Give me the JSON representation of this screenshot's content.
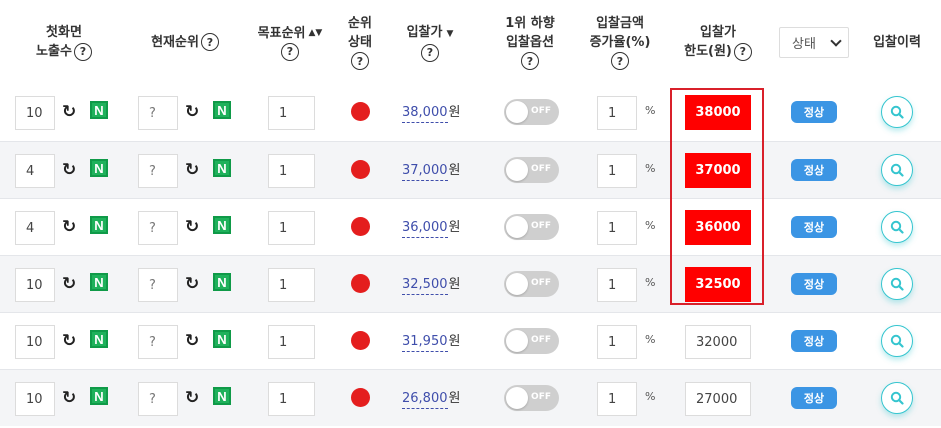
{
  "header": {
    "col_exposure_line1": "첫화면",
    "col_exposure_line2": "노출수",
    "col_current_rank": "현재순위",
    "col_target_rank": "목표순위",
    "col_rank_status_line1": "순위",
    "col_rank_status_line2": "상태",
    "col_bid": "입찰가",
    "col_option_line1": "1위 하향",
    "col_option_line2": "입찰옵션",
    "col_increase_line1": "입찰금액",
    "col_increase_line2": "증가율(%)",
    "col_limit_line1": "입찰가",
    "col_limit_line2": "한도(원)",
    "status_select": "상태",
    "col_history": "입찰이력",
    "help": "?",
    "sort_both": "▲▼",
    "sort_down": "▼"
  },
  "labels": {
    "naver": "N",
    "toggle": "OFF",
    "percent": "%",
    "won": "원"
  },
  "rows": [
    {
      "exposure": "10",
      "current_rank": "?",
      "target_rank": "1",
      "bid": "38,000",
      "increase": "1",
      "limit": "38000",
      "limit_highlight": true,
      "status": "정상"
    },
    {
      "exposure": "4",
      "current_rank": "?",
      "target_rank": "1",
      "bid": "37,000",
      "increase": "1",
      "limit": "37000",
      "limit_highlight": true,
      "status": "정상"
    },
    {
      "exposure": "4",
      "current_rank": "?",
      "target_rank": "1",
      "bid": "36,000",
      "increase": "1",
      "limit": "36000",
      "limit_highlight": true,
      "status": "정상"
    },
    {
      "exposure": "10",
      "current_rank": "?",
      "target_rank": "1",
      "bid": "32,500",
      "increase": "1",
      "limit": "32500",
      "limit_highlight": true,
      "status": "정상"
    },
    {
      "exposure": "10",
      "current_rank": "?",
      "target_rank": "1",
      "bid": "31,950",
      "increase": "1",
      "limit": "32000",
      "limit_highlight": false,
      "status": "정상"
    },
    {
      "exposure": "10",
      "current_rank": "?",
      "target_rank": "1",
      "bid": "26,800",
      "increase": "1",
      "limit": "27000",
      "limit_highlight": false,
      "status": "정상"
    }
  ],
  "colors": {
    "naver_green": "#1fb15b",
    "rank_dot_red": "#e41e1e",
    "limit_red": "#ff0000",
    "status_badge_blue": "#3b95e4",
    "search_teal": "#35c5cf",
    "highlight_frame": "#d9202a"
  }
}
